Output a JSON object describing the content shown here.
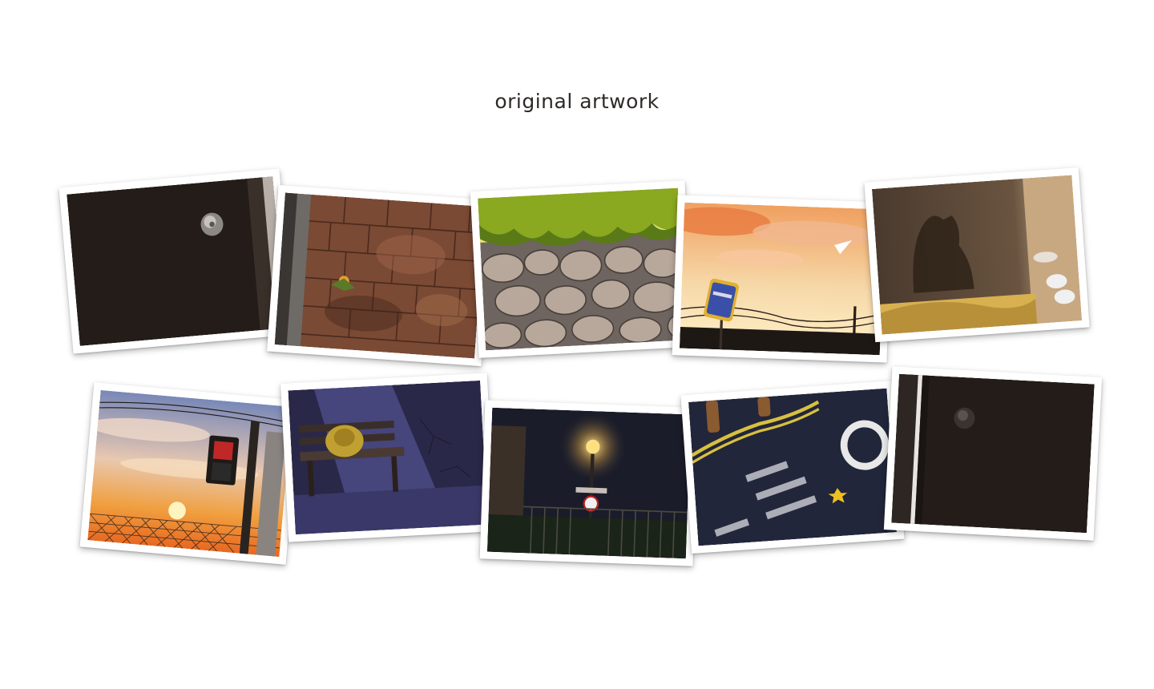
{
  "page": {
    "title": "original artwork"
  },
  "gallery": {
    "photos": [
      {
        "subject": "dark door with knob"
      },
      {
        "subject": "brick sidewalk with flower"
      },
      {
        "subject": "stone wall with grass"
      },
      {
        "subject": "sunset sky with bus stop sign and paper plane"
      },
      {
        "subject": "dog shadow in doorway"
      },
      {
        "subject": "sunset with pedestrian signal and fence"
      },
      {
        "subject": "backpack on bench at night"
      },
      {
        "subject": "street lamp and fence at night"
      },
      {
        "subject": "road markings at night"
      },
      {
        "subject": "dark door with knob"
      }
    ]
  },
  "colors": {
    "background": "#ffffff",
    "frame": "#ffffff",
    "title": "#2e2a28"
  }
}
